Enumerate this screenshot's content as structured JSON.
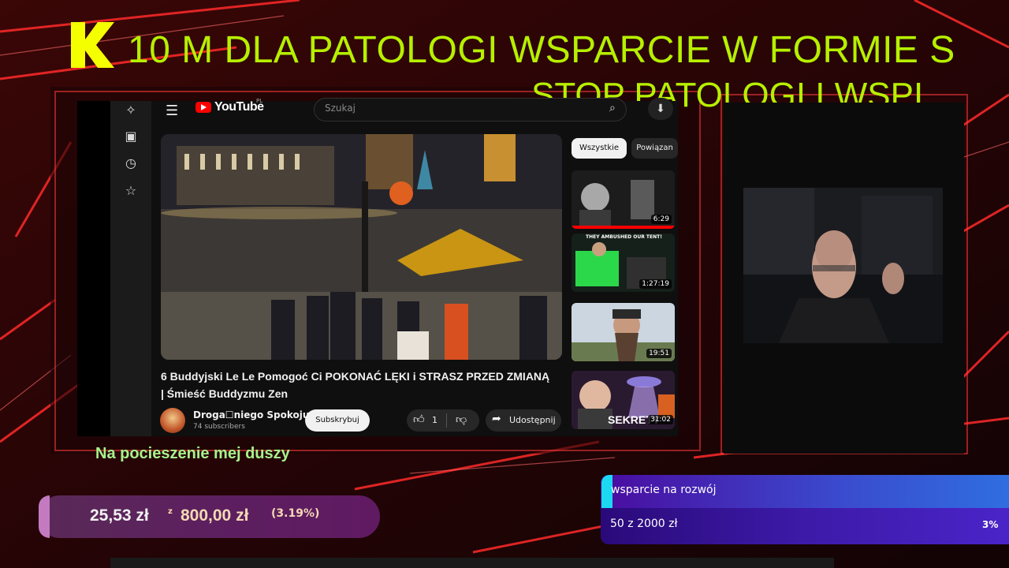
{
  "overlay": {
    "ticker_line1": "10 M DLA PATOLOGI WSPARCIE  W FORMIE S",
    "ticker_line2": "STOP PATOLOGI I WSPI",
    "logo_letter": "K",
    "accent_color": "#b6f000"
  },
  "youtube": {
    "logo_text": "YouTube",
    "country_code": "PL",
    "search_placeholder": "Szukaj",
    "video": {
      "title": "6 Buddyjski Le Le Pomogoć Ci POKONAĆ LĘKI i STRASZ PRZED ZMIANĄ | Śmieść Buddyzmu Zen",
      "channel": "Droga☐niego Spokoju",
      "subscribers": "74 subscribers",
      "subscribe_label": "Subskrybuj",
      "likes": "1",
      "share_label": "Udostępnij"
    },
    "chips": [
      "Wszystkie",
      "Powiązan"
    ],
    "recommendations": [
      {
        "duration": "6:29",
        "overlay_text": ""
      },
      {
        "duration": "1:27:19",
        "overlay_text": "THEY AMBUSHED OUR TENT!"
      },
      {
        "duration": "19:51",
        "overlay_text": ""
      },
      {
        "duration": "31:02",
        "overlay_text": "SEKRETY"
      }
    ]
  },
  "caption": "Na pocieszenie mej duszy",
  "goal_pln": {
    "current": "25,53 zł",
    "separator": "z",
    "target": "800,00 zł",
    "percent": "(3.19%)",
    "progress_fraction": 0.0319
  },
  "goal_rozwoj": {
    "title": "wsparcie na rozwój",
    "progress_text": "50  z  2000  zł",
    "percent": "3%",
    "progress_fraction": 0.03
  },
  "icons": [
    "sparkle-icon",
    "save-icon",
    "history-icon",
    "star-icon",
    "menu-icon",
    "search-icon",
    "mic-icon",
    "like-icon",
    "dislike-icon",
    "share-icon"
  ]
}
